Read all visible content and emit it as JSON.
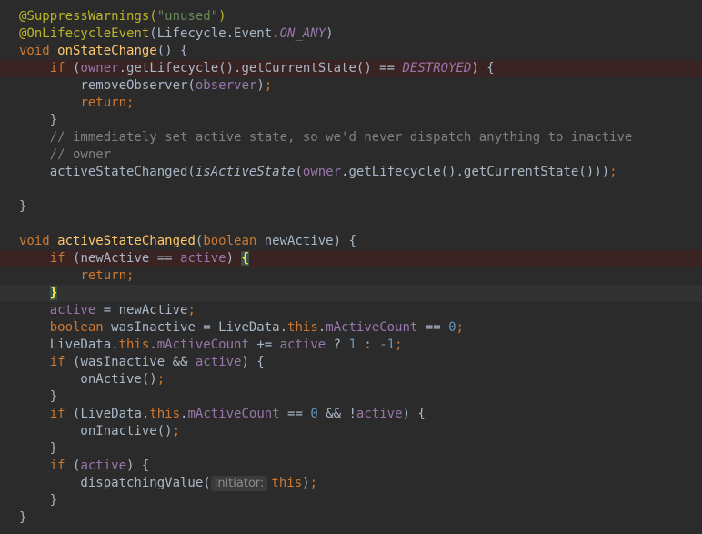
{
  "code": {
    "lines": [
      [
        [
          "ann",
          "@SuppressWarnings("
        ],
        [
          "str",
          "\"unused\""
        ],
        [
          "ann",
          ")"
        ]
      ],
      [
        [
          "ann",
          "@OnLifecycleEvent"
        ],
        [
          "pl",
          "(Lifecycle.Event."
        ],
        [
          "const",
          "ON_ANY"
        ],
        [
          "pl",
          ")"
        ]
      ],
      [
        [
          "kw",
          "void "
        ],
        [
          "fn",
          "onStateChange"
        ],
        [
          "pl",
          "() {"
        ]
      ],
      [
        [
          "pl",
          "    "
        ],
        [
          "kw",
          "if "
        ],
        [
          "pl",
          "("
        ],
        [
          "field",
          "owner"
        ],
        [
          "pl",
          ".getLifecycle().getCurrentState() == "
        ],
        [
          "const",
          "DESTROYED"
        ],
        [
          "pl",
          ") {"
        ]
      ],
      [
        [
          "pl",
          "        removeObserver("
        ],
        [
          "field",
          "observer"
        ],
        [
          "pl",
          ")"
        ],
        [
          "kw",
          ";"
        ]
      ],
      [
        [
          "pl",
          "        "
        ],
        [
          "kw",
          "return;"
        ]
      ],
      [
        [
          "pl",
          "    }"
        ]
      ],
      [
        [
          "pl",
          "    "
        ],
        [
          "cmt",
          "// immediately set active state, so we'd never dispatch anything to inactive"
        ]
      ],
      [
        [
          "pl",
          "    "
        ],
        [
          "cmt",
          "// owner"
        ]
      ],
      [
        [
          "pl",
          "    activeStateChanged("
        ],
        [
          "stat",
          "isActiveState"
        ],
        [
          "pl",
          "("
        ],
        [
          "field",
          "owner"
        ],
        [
          "pl",
          ".getLifecycle().getCurrentState()))"
        ],
        [
          "kw",
          ";"
        ]
      ],
      [],
      [
        [
          "pl",
          "}"
        ]
      ],
      [],
      [
        [
          "kw",
          "void "
        ],
        [
          "fn",
          "activeStateChanged"
        ],
        [
          "pl",
          "("
        ],
        [
          "kw",
          "boolean "
        ],
        [
          "pl",
          "newActive) {"
        ]
      ],
      [
        [
          "pl",
          "    "
        ],
        [
          "kw",
          "if "
        ],
        [
          "pl",
          "(newActive == "
        ],
        [
          "field",
          "active"
        ],
        [
          "pl",
          ") "
        ],
        [
          "brace-match",
          "{"
        ]
      ],
      [
        [
          "pl",
          "        "
        ],
        [
          "kw",
          "return;"
        ]
      ],
      [
        [
          "pl",
          "    "
        ],
        [
          "brace-match",
          "}"
        ]
      ],
      [
        [
          "pl",
          "    "
        ],
        [
          "field",
          "active "
        ],
        [
          "pl",
          "= newActive"
        ],
        [
          "kw",
          ";"
        ]
      ],
      [
        [
          "pl",
          "    "
        ],
        [
          "kw",
          "boolean "
        ],
        [
          "pl",
          "wasInactive = LiveData."
        ],
        [
          "kw",
          "this"
        ],
        [
          "pl",
          "."
        ],
        [
          "field",
          "mActiveCount "
        ],
        [
          "pl",
          "== "
        ],
        [
          "num",
          "0"
        ],
        [
          "kw",
          ";"
        ]
      ],
      [
        [
          "pl",
          "    LiveData."
        ],
        [
          "kw",
          "this"
        ],
        [
          "pl",
          "."
        ],
        [
          "field",
          "mActiveCount "
        ],
        [
          "pl",
          "+= "
        ],
        [
          "field",
          "active "
        ],
        [
          "pl",
          "? "
        ],
        [
          "num",
          "1 "
        ],
        [
          "pl",
          ": "
        ],
        [
          "num",
          "-1"
        ],
        [
          "kw",
          ";"
        ]
      ],
      [
        [
          "pl",
          "    "
        ],
        [
          "kw",
          "if "
        ],
        [
          "pl",
          "(wasInactive && "
        ],
        [
          "field",
          "active"
        ],
        [
          "pl",
          ") {"
        ]
      ],
      [
        [
          "pl",
          "        onActive()"
        ],
        [
          "kw",
          ";"
        ]
      ],
      [
        [
          "pl",
          "    }"
        ]
      ],
      [
        [
          "pl",
          "    "
        ],
        [
          "kw",
          "if "
        ],
        [
          "pl",
          "(LiveData."
        ],
        [
          "kw",
          "this"
        ],
        [
          "pl",
          "."
        ],
        [
          "field",
          "mActiveCount "
        ],
        [
          "pl",
          "== "
        ],
        [
          "num",
          "0 "
        ],
        [
          "pl",
          "&& !"
        ],
        [
          "field",
          "active"
        ],
        [
          "pl",
          ") {"
        ]
      ],
      [
        [
          "pl",
          "        onInactive()"
        ],
        [
          "kw",
          ";"
        ]
      ],
      [
        [
          "pl",
          "    }"
        ]
      ],
      [
        [
          "pl",
          "    "
        ],
        [
          "kw",
          "if "
        ],
        [
          "pl",
          "("
        ],
        [
          "field",
          "active"
        ],
        [
          "pl",
          ") {"
        ]
      ],
      [
        [
          "pl",
          "        dispatchingValue("
        ],
        [
          "hint",
          "initiator:"
        ],
        [
          "kw",
          "this"
        ],
        [
          "pl",
          ")"
        ],
        [
          "kw",
          ";"
        ]
      ],
      [
        [
          "pl",
          "    }"
        ]
      ],
      [
        [
          "pl",
          "}"
        ]
      ]
    ],
    "breakpoint_line_indices": [
      3,
      14
    ],
    "caret_line_index": 16
  },
  "colors": {
    "background": "#2b2b2b",
    "plain_text": "#a9b7c6",
    "keyword": "#cc7832",
    "annotation": "#bbb529",
    "string": "#6a8759",
    "number": "#6897bb",
    "field": "#9876aa",
    "method_declaration": "#ffc66d",
    "comment": "#808080",
    "breakpoint_line_bg": "#3a2323",
    "caret_line_bg": "#323232"
  }
}
